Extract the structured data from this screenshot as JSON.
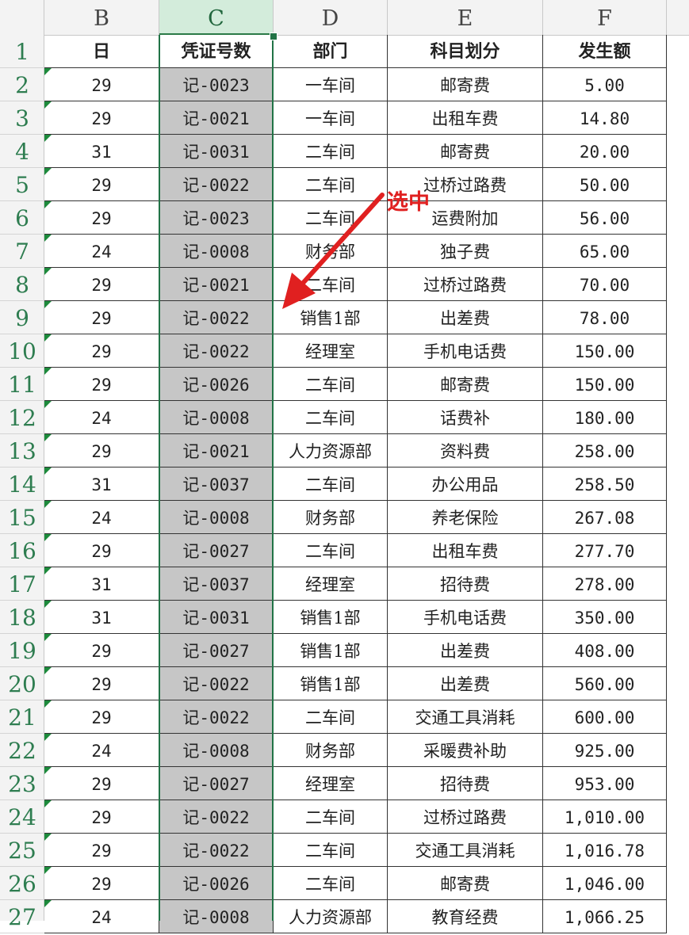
{
  "columns": [
    "B",
    "C",
    "D",
    "E",
    "F"
  ],
  "header": {
    "day": "日",
    "voucher": "凭证号数",
    "dept": "部门",
    "subject": "科目划分",
    "amount": "发生额"
  },
  "row_numbers": [
    "1",
    "2",
    "3",
    "4",
    "5",
    "6",
    "7",
    "8",
    "9",
    "10",
    "11",
    "12",
    "13",
    "14",
    "15",
    "16",
    "17",
    "18",
    "19",
    "20",
    "21",
    "22",
    "23",
    "24",
    "25",
    "26",
    "27"
  ],
  "rows": [
    {
      "day": "29",
      "voucher": "记-0023",
      "dept": "一车间",
      "subject": "邮寄费",
      "amount": "5.00"
    },
    {
      "day": "29",
      "voucher": "记-0021",
      "dept": "一车间",
      "subject": "出租车费",
      "amount": "14.80"
    },
    {
      "day": "31",
      "voucher": "记-0031",
      "dept": "二车间",
      "subject": "邮寄费",
      "amount": "20.00"
    },
    {
      "day": "29",
      "voucher": "记-0022",
      "dept": "二车间",
      "subject": "过桥过路费",
      "amount": "50.00"
    },
    {
      "day": "29",
      "voucher": "记-0023",
      "dept": "二车间",
      "subject": "运费附加",
      "amount": "56.00"
    },
    {
      "day": "24",
      "voucher": "记-0008",
      "dept": "财务部",
      "subject": "独子费",
      "amount": "65.00"
    },
    {
      "day": "29",
      "voucher": "记-0021",
      "dept": "二车间",
      "subject": "过桥过路费",
      "amount": "70.00"
    },
    {
      "day": "29",
      "voucher": "记-0022",
      "dept": "销售1部",
      "subject": "出差费",
      "amount": "78.00"
    },
    {
      "day": "29",
      "voucher": "记-0022",
      "dept": "经理室",
      "subject": "手机电话费",
      "amount": "150.00"
    },
    {
      "day": "29",
      "voucher": "记-0026",
      "dept": "二车间",
      "subject": "邮寄费",
      "amount": "150.00"
    },
    {
      "day": "24",
      "voucher": "记-0008",
      "dept": "二车间",
      "subject": "话费补",
      "amount": "180.00"
    },
    {
      "day": "29",
      "voucher": "记-0021",
      "dept": "人力资源部",
      "subject": "资料费",
      "amount": "258.00"
    },
    {
      "day": "31",
      "voucher": "记-0037",
      "dept": "二车间",
      "subject": "办公用品",
      "amount": "258.50"
    },
    {
      "day": "24",
      "voucher": "记-0008",
      "dept": "财务部",
      "subject": "养老保险",
      "amount": "267.08"
    },
    {
      "day": "29",
      "voucher": "记-0027",
      "dept": "二车间",
      "subject": "出租车费",
      "amount": "277.70"
    },
    {
      "day": "31",
      "voucher": "记-0037",
      "dept": "经理室",
      "subject": "招待费",
      "amount": "278.00"
    },
    {
      "day": "31",
      "voucher": "记-0031",
      "dept": "销售1部",
      "subject": "手机电话费",
      "amount": "350.00"
    },
    {
      "day": "29",
      "voucher": "记-0027",
      "dept": "销售1部",
      "subject": "出差费",
      "amount": "408.00"
    },
    {
      "day": "29",
      "voucher": "记-0022",
      "dept": "销售1部",
      "subject": "出差费",
      "amount": "560.00"
    },
    {
      "day": "29",
      "voucher": "记-0022",
      "dept": "二车间",
      "subject": "交通工具消耗",
      "amount": "600.00"
    },
    {
      "day": "24",
      "voucher": "记-0008",
      "dept": "财务部",
      "subject": "采暖费补助",
      "amount": "925.00"
    },
    {
      "day": "29",
      "voucher": "记-0027",
      "dept": "经理室",
      "subject": "招待费",
      "amount": "953.00"
    },
    {
      "day": "29",
      "voucher": "记-0022",
      "dept": "二车间",
      "subject": "过桥过路费",
      "amount": "1,010.00"
    },
    {
      "day": "29",
      "voucher": "记-0022",
      "dept": "二车间",
      "subject": "交通工具消耗",
      "amount": "1,016.78"
    },
    {
      "day": "29",
      "voucher": "记-0026",
      "dept": "二车间",
      "subject": "邮寄费",
      "amount": "1,046.00"
    },
    {
      "day": "24",
      "voucher": "记-0008",
      "dept": "人力资源部",
      "subject": "教育经费",
      "amount": "1,066.25"
    }
  ],
  "annotation": {
    "label": "选中",
    "color": "#e02020"
  },
  "selection": {
    "column": "C",
    "accent_color": "#217346",
    "fill_color": "#c6c6c6"
  }
}
